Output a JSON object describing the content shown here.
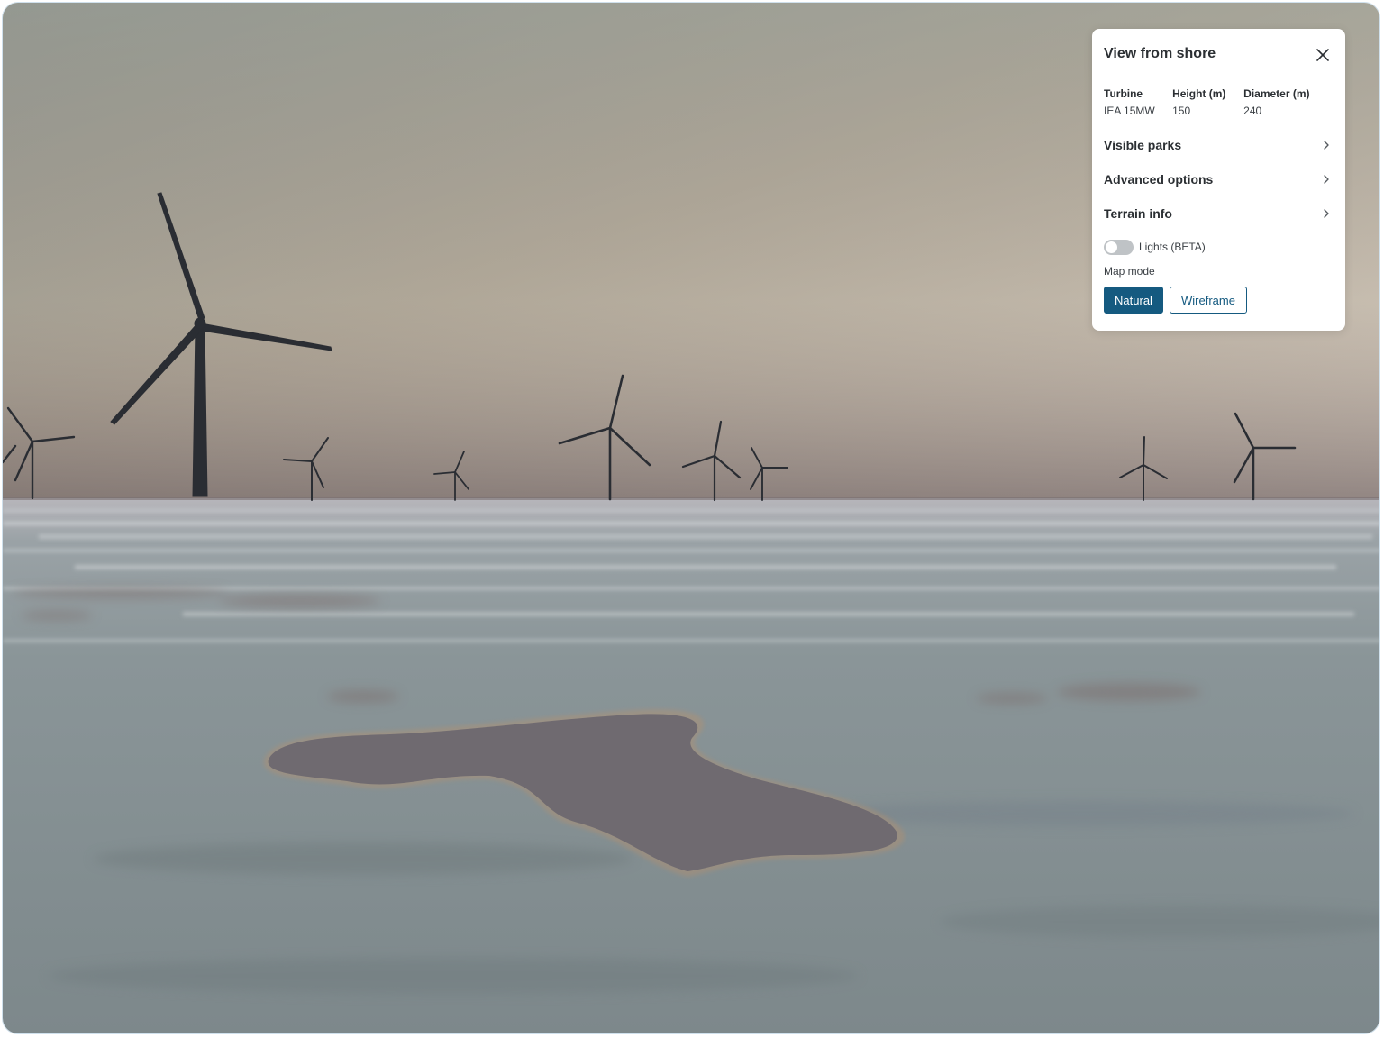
{
  "panel": {
    "title": "View from shore",
    "close_icon": "close-icon",
    "specs": [
      {
        "label": "Turbine",
        "value": "IEA 15MW"
      },
      {
        "label": "Height (m)",
        "value": "150"
      },
      {
        "label": "Diameter (m)",
        "value": "240"
      }
    ],
    "sections": [
      {
        "label": "Visible parks",
        "icon": "chevron-right-icon"
      },
      {
        "label": "Advanced options",
        "icon": "chevron-right-icon"
      },
      {
        "label": "Terrain info",
        "icon": "chevron-right-icon"
      }
    ],
    "lights": {
      "label": "Lights (BETA)",
      "enabled": false
    },
    "map_mode": {
      "label": "Map mode",
      "options": [
        "Natural",
        "Wireframe"
      ],
      "selected": "Natural"
    }
  },
  "colors": {
    "accent": "#155a80",
    "turbine": "#2a2d33",
    "sea": "#7e8a8c"
  }
}
